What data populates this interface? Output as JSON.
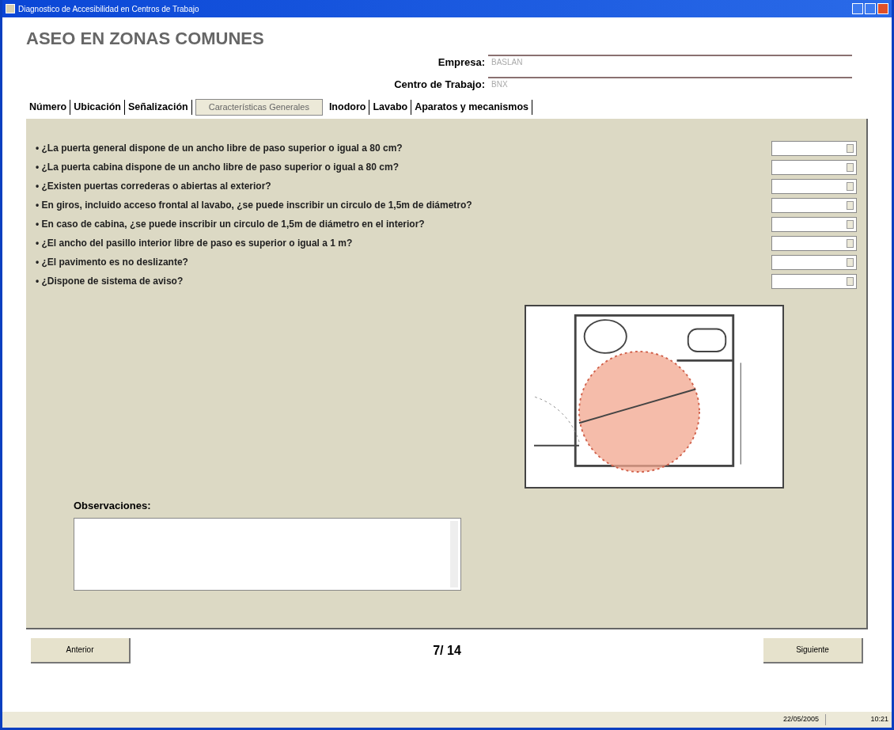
{
  "window": {
    "title": "Diagnostico de Accesibilidad en Centros de Trabajo"
  },
  "heading": "ASEO EN ZONAS COMUNES",
  "fields": [
    {
      "label": "Empresa:",
      "value": "BASLAN"
    },
    {
      "label": "Centro de Trabajo:",
      "value": "BNX"
    }
  ],
  "tabs": [
    {
      "label": "Número",
      "selected": false
    },
    {
      "label": "Ubicación",
      "selected": false
    },
    {
      "label": "Señalización",
      "selected": false
    },
    {
      "label": "Características Generales",
      "selected": true
    },
    {
      "label": "Inodoro",
      "selected": false
    },
    {
      "label": "Lavabo",
      "selected": false
    },
    {
      "label": "Aparatos y mecanismos",
      "selected": false
    }
  ],
  "questions": [
    {
      "text": "• ¿La puerta general dispone de un ancho libre de paso superior o igual a 80 cm?"
    },
    {
      "text": "• ¿La puerta cabina dispone de un ancho libre de paso superior o igual a 80 cm?"
    },
    {
      "text": "• ¿Existen puertas correderas o abiertas al exterior?"
    },
    {
      "text": "• En giros, incluido acceso frontal al lavabo, ¿se puede inscribir un circulo de 1,5m de diámetro?"
    },
    {
      "text": "• En caso de cabina, ¿se puede inscribir un circulo de 1,5m de diámetro en el interior?"
    },
    {
      "text": "• ¿El ancho del pasillo interior libre de paso es superior o igual a 1 m?"
    },
    {
      "text": "• ¿El pavimento es no deslizante?"
    },
    {
      "text": "• ¿Dispone de sistema de aviso?"
    }
  ],
  "observations": {
    "label": "Observaciones:"
  },
  "navigation": {
    "previous": "Anterior",
    "page": "7/ 14",
    "next": "Siguiente"
  },
  "status_bar": {
    "date": "22/05/2005",
    "time": "10:21"
  }
}
